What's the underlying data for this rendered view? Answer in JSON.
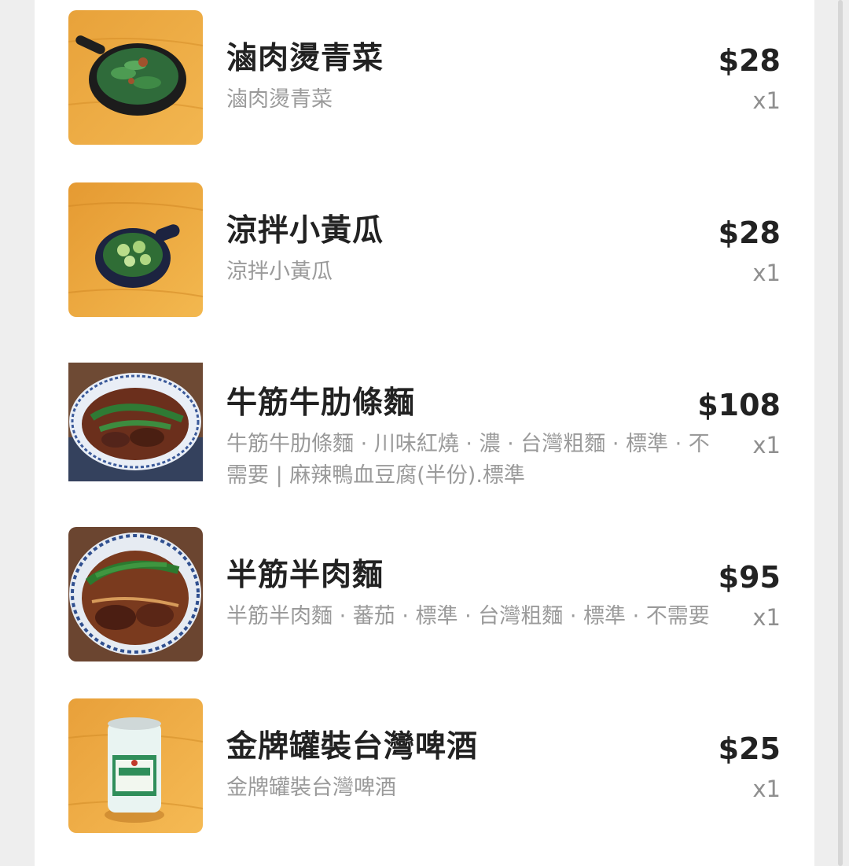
{
  "order": {
    "items": [
      {
        "name": "滷肉燙青菜",
        "description": "滷肉燙青菜",
        "price": "$28",
        "quantity": "x1",
        "image_icon": "greens-dish-photo"
      },
      {
        "name": "涼拌小黃瓜",
        "description": "涼拌小黃瓜",
        "price": "$28",
        "quantity": "x1",
        "image_icon": "cucumber-dish-photo"
      },
      {
        "name": "牛筋牛肋條麵",
        "description": "牛筋牛肋條麵 · 川味紅燒 · 濃 · 台灣粗麵 · 標準 · 不需要 | 麻辣鴨血豆腐(半份).標準",
        "price": "$108",
        "quantity": "x1",
        "image_icon": "beef-noodle-photo"
      },
      {
        "name": "半筋半肉麵",
        "description": "半筋半肉麵 · 蕃茄 · 標準 · 台灣粗麵 · 標準 · 不需要",
        "price": "$95",
        "quantity": "x1",
        "image_icon": "beef-noodle-bowl-photo"
      },
      {
        "name": "金牌罐裝台灣啤酒",
        "description": "金牌罐裝台灣啤酒",
        "price": "$25",
        "quantity": "x1",
        "image_icon": "beer-can-photo"
      }
    ]
  },
  "colors": {
    "page_background": "#eeeeee",
    "card_background": "#ffffff",
    "title_text": "#222222",
    "description_text": "#9a9a9a"
  }
}
